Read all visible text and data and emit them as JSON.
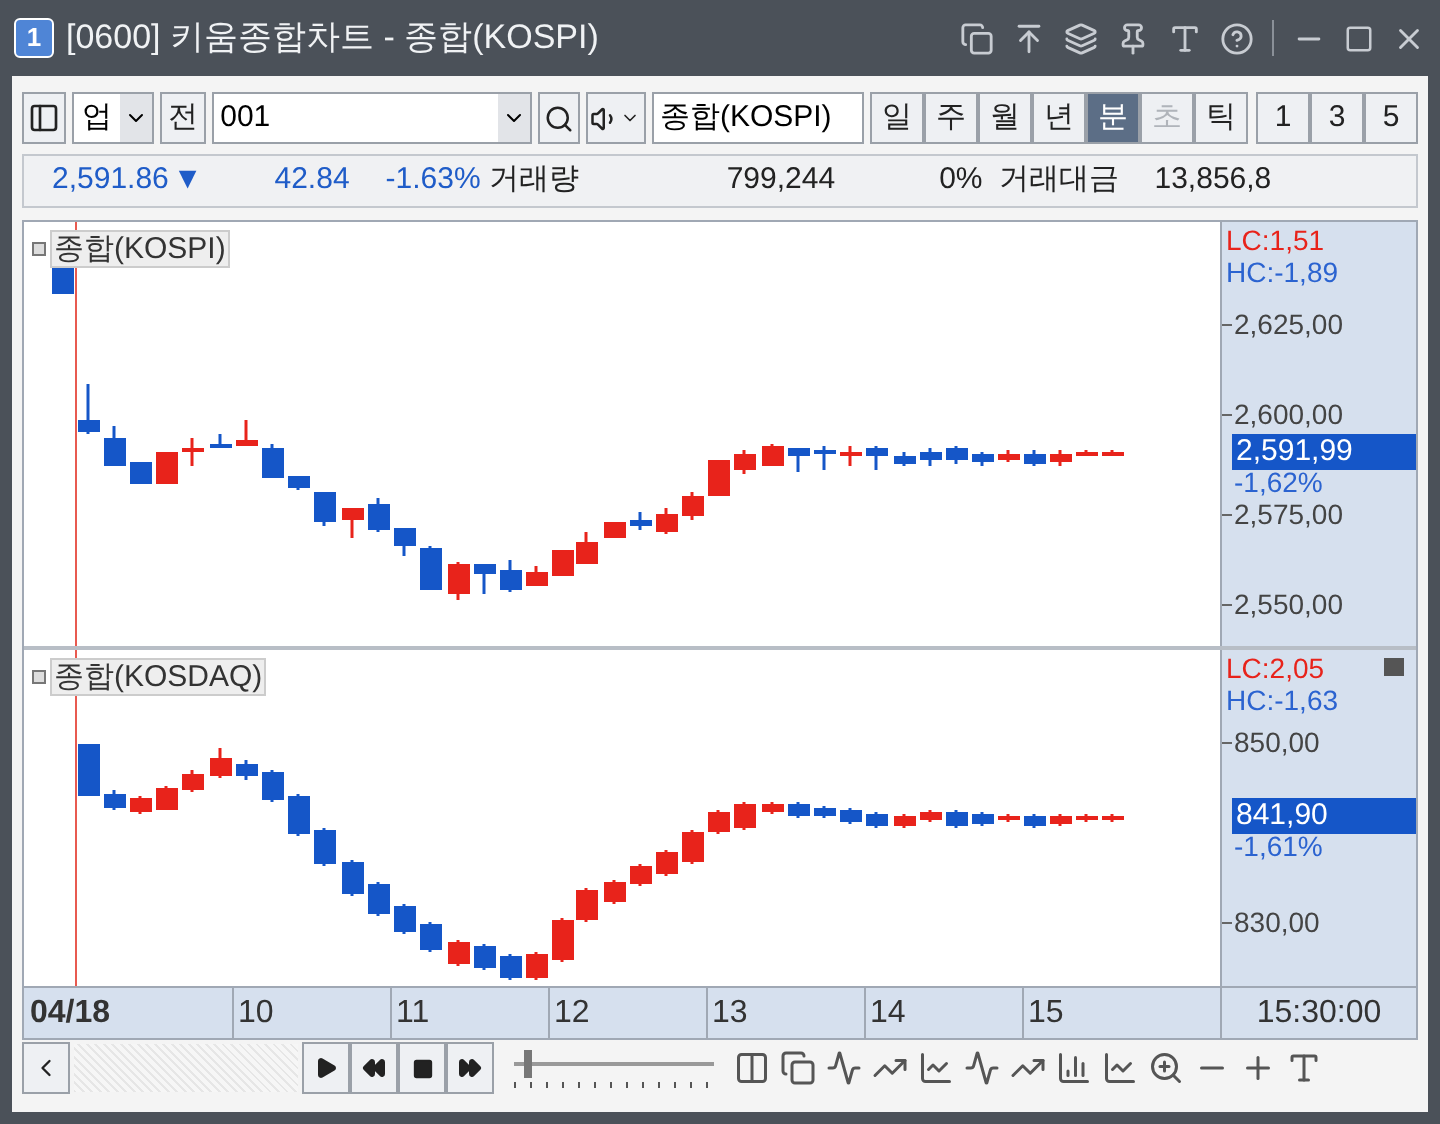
{
  "window": {
    "badge": "1",
    "title": "[0600] 키움종합차트 - 종합(KOSPI)"
  },
  "toolbar": {
    "market": "업",
    "all_button": "전",
    "code": "001",
    "name_field": "종합(KOSPI)",
    "periods": [
      {
        "label": "일",
        "selected": false,
        "disabled": false
      },
      {
        "label": "주",
        "selected": false,
        "disabled": false
      },
      {
        "label": "월",
        "selected": false,
        "disabled": false
      },
      {
        "label": "년",
        "selected": false,
        "disabled": false
      },
      {
        "label": "분",
        "selected": true,
        "disabled": false
      },
      {
        "label": "초",
        "selected": false,
        "disabled": true
      },
      {
        "label": "틱",
        "selected": false,
        "disabled": false
      },
      {
        "label": "1",
        "selected": false,
        "disabled": false
      },
      {
        "label": "3",
        "selected": false,
        "disabled": false
      },
      {
        "label": "5",
        "selected": false,
        "disabled": false
      }
    ]
  },
  "quote": {
    "price": "2,591.86",
    "direction": "▼",
    "change": "42.84",
    "change_rate": "-1.63%",
    "volume_label": "거래량",
    "volume": "799,244",
    "volume_rate": "0%",
    "amount_label": "거래대금",
    "amount": "13,856,8"
  },
  "panels": [
    {
      "legend": "종합(KOSPI)",
      "lc": "LC:1,51",
      "hc": "HC:-1,89",
      "ticks": [
        "2,625,00",
        "2,600,00",
        "2,575,00",
        "2,550,00"
      ],
      "current": "2,591,99",
      "current_rate": "-1,62%"
    },
    {
      "legend": "종합(KOSDAQ)",
      "lc": "LC:2,05",
      "hc": "HC:-1,63",
      "ticks": [
        "850,00",
        "830,00"
      ],
      "current": "841,90",
      "current_rate": "-1,61%"
    }
  ],
  "time_axis": {
    "date": "04/18",
    "hours": [
      "10",
      "11",
      "12",
      "13",
      "14",
      "15"
    ],
    "time": "15:30:00"
  },
  "zoom_slider": {
    "level": 0.05
  }
}
